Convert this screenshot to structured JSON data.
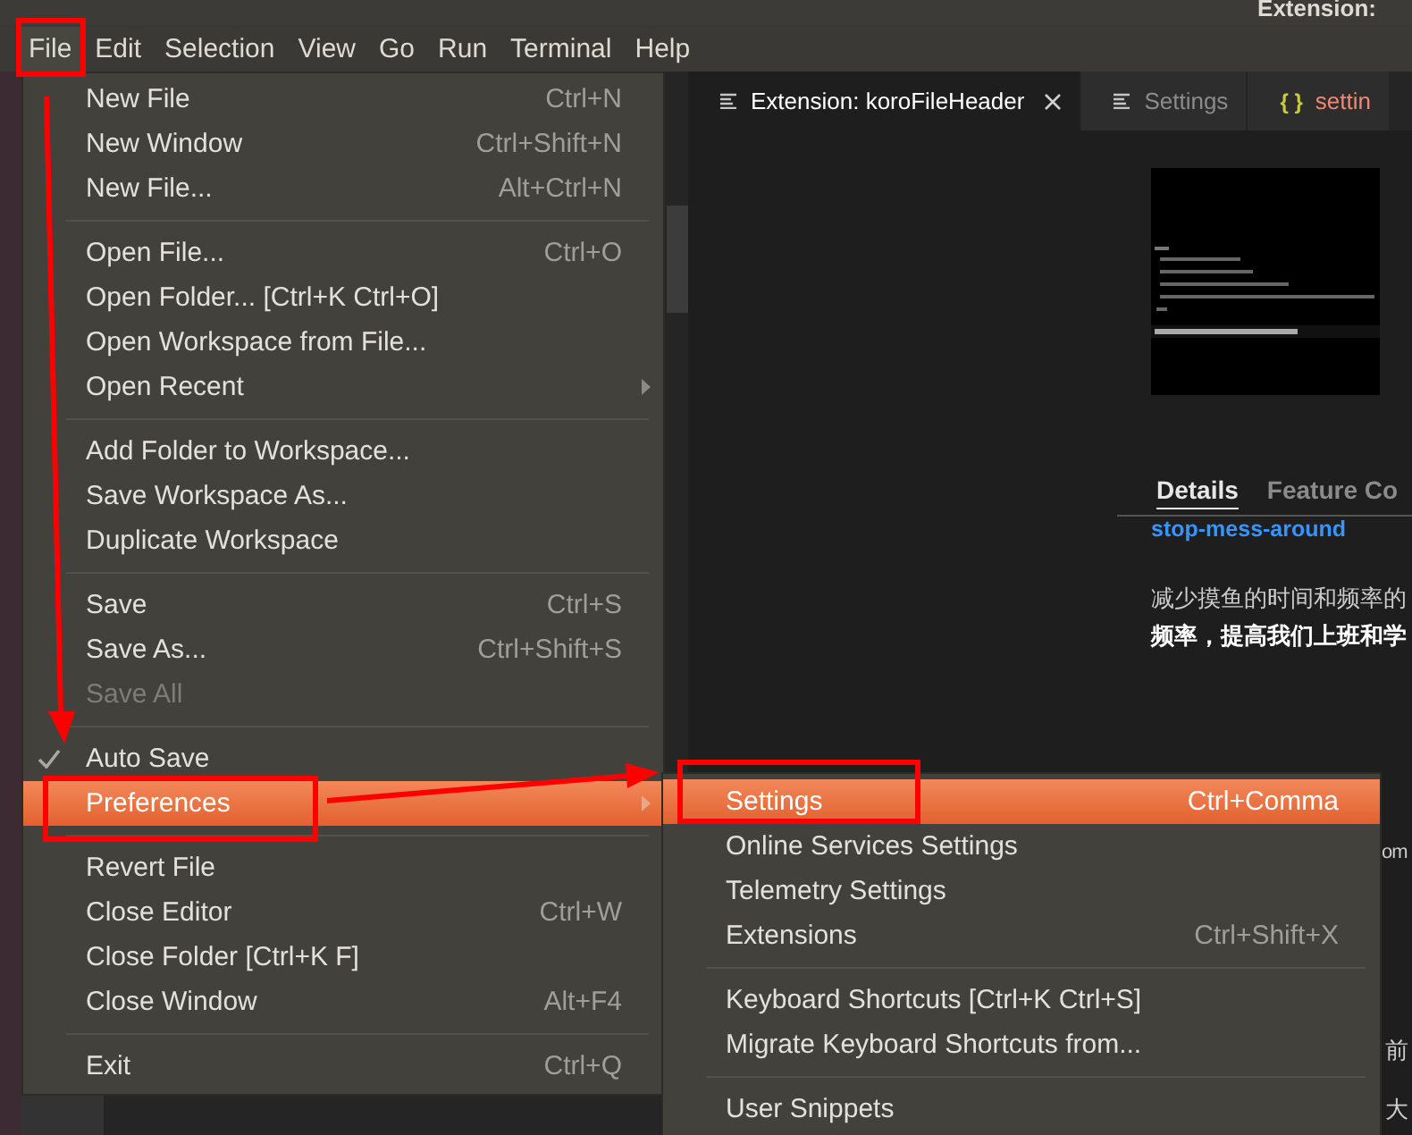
{
  "title_bar": {
    "title": "Extension:"
  },
  "menubar": [
    {
      "label": "File",
      "selected": true
    },
    {
      "label": "Edit",
      "selected": false
    },
    {
      "label": "Selection",
      "selected": false
    },
    {
      "label": "View",
      "selected": false
    },
    {
      "label": "Go",
      "selected": false
    },
    {
      "label": "Run",
      "selected": false
    },
    {
      "label": "Terminal",
      "selected": false
    },
    {
      "label": "Help",
      "selected": false
    }
  ],
  "tabs": [
    {
      "label": "Extension: koroFileHeader",
      "kind": "preview",
      "selected": true
    },
    {
      "label": "Settings",
      "kind": "preview",
      "selected": false
    },
    {
      "label": "settin",
      "kind": "json",
      "icon_text": "{ }",
      "selected": false
    }
  ],
  "readme": {
    "detail_tabs": [
      {
        "label": "Details",
        "selected": true
      },
      {
        "label": "Feature Co",
        "selected": false
      }
    ],
    "heading": "stop-mess-around",
    "paragraph": [
      "减少摸鱼的时间和频率的",
      "**频率，提高我们上班和学**"
    ],
    "fragments": [
      "om",
      "前",
      "大"
    ]
  },
  "file_menu": {
    "groups": [
      [
        {
          "label": "New File",
          "shortcut": "Ctrl+N",
          "checked": false,
          "disabled": false,
          "selected": false,
          "submenu": false
        },
        {
          "label": "New Window",
          "shortcut": "Ctrl+Shift+N",
          "checked": false,
          "disabled": false,
          "selected": false,
          "submenu": false
        },
        {
          "label": "New File...",
          "shortcut": "Alt+Ctrl+N",
          "checked": false,
          "disabled": false,
          "selected": false,
          "submenu": false
        }
      ],
      [
        {
          "label": "Open File...",
          "shortcut": "Ctrl+O",
          "checked": false,
          "disabled": false,
          "selected": false,
          "submenu": false
        },
        {
          "label": "Open Folder... [Ctrl+K Ctrl+O]",
          "checked": false,
          "disabled": false,
          "selected": false,
          "submenu": false
        },
        {
          "label": "Open Workspace from File...",
          "checked": false,
          "disabled": false,
          "selected": false,
          "submenu": false
        },
        {
          "label": "Open Recent",
          "checked": false,
          "disabled": false,
          "selected": false,
          "submenu": true
        }
      ],
      [
        {
          "label": "Add Folder to Workspace...",
          "checked": false,
          "disabled": false,
          "selected": false,
          "submenu": false
        },
        {
          "label": "Save Workspace As...",
          "checked": false,
          "disabled": false,
          "selected": false,
          "submenu": false
        },
        {
          "label": "Duplicate Workspace",
          "checked": false,
          "disabled": false,
          "selected": false,
          "submenu": false
        }
      ],
      [
        {
          "label": "Save",
          "shortcut": "Ctrl+S",
          "checked": false,
          "disabled": false,
          "selected": false,
          "submenu": false
        },
        {
          "label": "Save As...",
          "shortcut": "Ctrl+Shift+S",
          "checked": false,
          "disabled": false,
          "selected": false,
          "submenu": false
        },
        {
          "label": "Save All",
          "checked": false,
          "disabled": true,
          "selected": false,
          "submenu": false
        }
      ],
      [
        {
          "label": "Auto Save",
          "checked": true,
          "disabled": false,
          "selected": false,
          "submenu": false
        },
        {
          "label": "Preferences",
          "checked": false,
          "disabled": false,
          "selected": true,
          "submenu": true
        }
      ],
      [
        {
          "label": "Revert File",
          "checked": false,
          "disabled": false,
          "selected": false,
          "submenu": false
        },
        {
          "label": "Close Editor",
          "shortcut": "Ctrl+W",
          "checked": false,
          "disabled": false,
          "selected": false,
          "submenu": false
        },
        {
          "label": "Close Folder [Ctrl+K F]",
          "checked": false,
          "disabled": false,
          "selected": false,
          "submenu": false
        },
        {
          "label": "Close Window",
          "shortcut": "Alt+F4",
          "checked": false,
          "disabled": false,
          "selected": false,
          "submenu": false
        }
      ],
      [
        {
          "label": "Exit",
          "shortcut": "Ctrl+Q",
          "checked": false,
          "disabled": false,
          "selected": false,
          "submenu": false
        }
      ]
    ]
  },
  "preferences_submenu": {
    "groups": [
      [
        {
          "label": "Settings",
          "shortcut": "Ctrl+Comma",
          "selected": true
        },
        {
          "label": "Online Services Settings",
          "selected": false
        },
        {
          "label": "Telemetry Settings",
          "selected": false
        },
        {
          "label": "Extensions",
          "shortcut": "Ctrl+Shift+X",
          "selected": false
        }
      ],
      [
        {
          "label": "Keyboard Shortcuts [Ctrl+K Ctrl+S]",
          "selected": false
        },
        {
          "label": "Migrate Keyboard Shortcuts from...",
          "selected": false
        }
      ],
      [
        {
          "label": "User Snippets",
          "selected": false
        }
      ]
    ]
  }
}
